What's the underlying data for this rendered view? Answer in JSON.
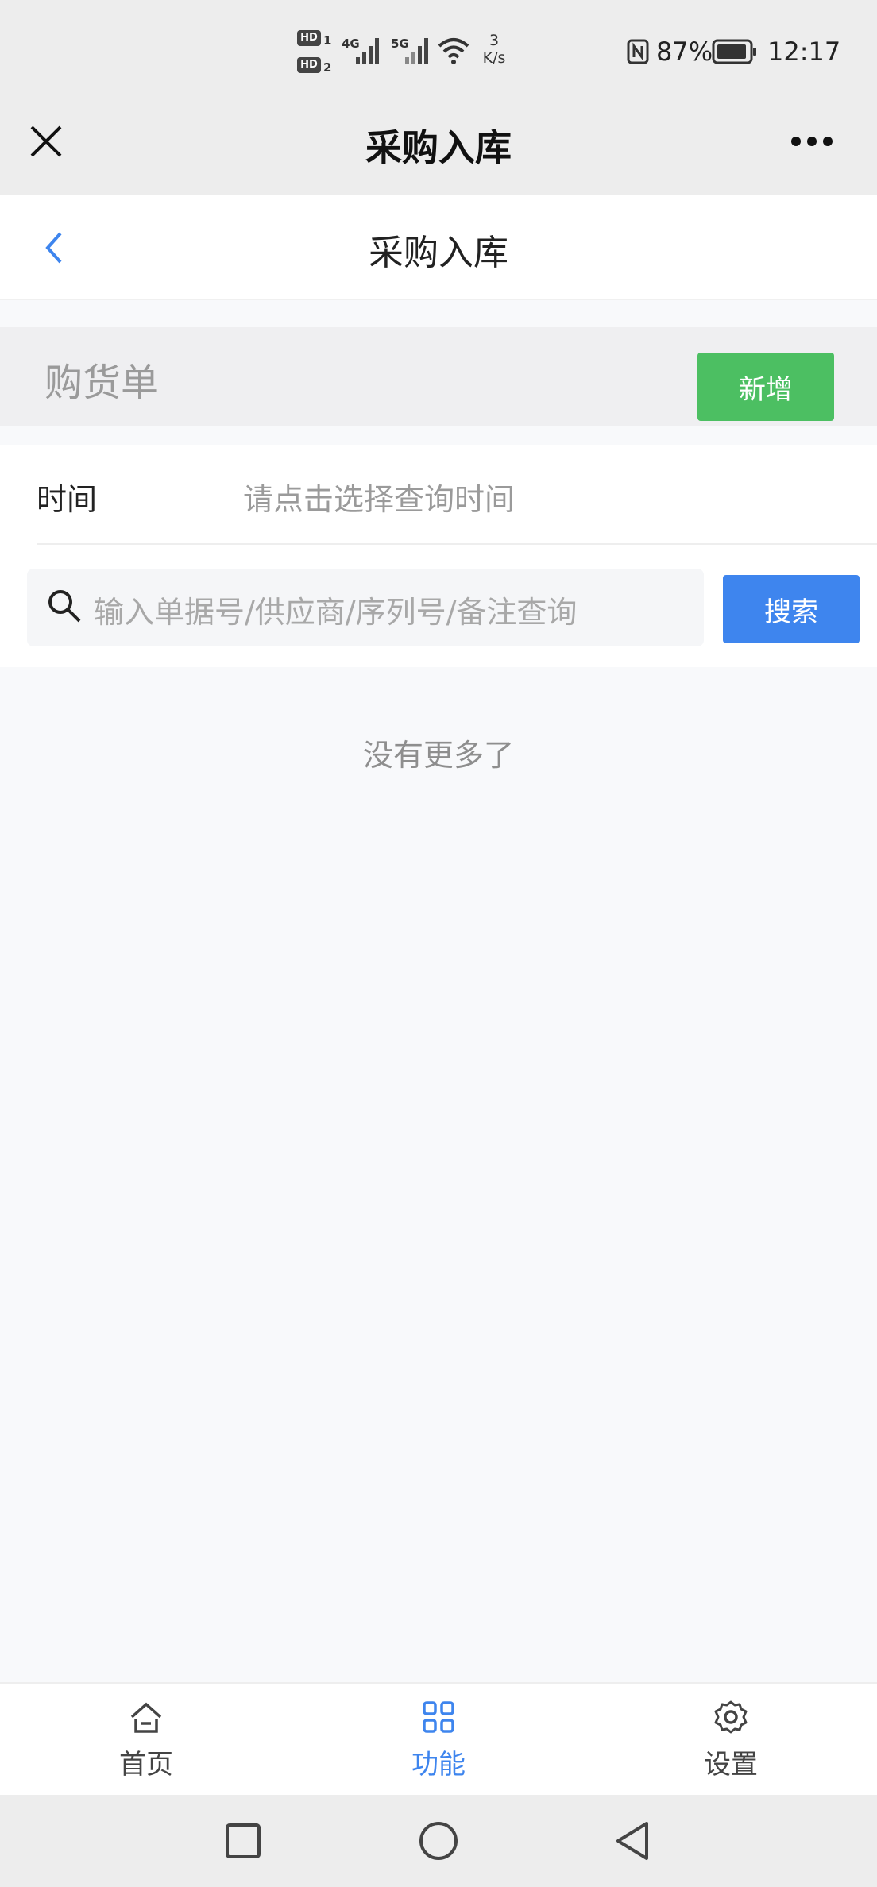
{
  "status_bar": {
    "hd1": "HD",
    "hd1_sub": "1",
    "hd2": "HD",
    "hd2_sub": "2",
    "net4g": "4G",
    "net5g": "5G",
    "speed_value": "3",
    "speed_unit": "K/s",
    "battery": "87%",
    "time": "12:17"
  },
  "wechat_bar": {
    "title": "采购入库"
  },
  "header": {
    "title": "采购入库"
  },
  "section": {
    "title": "购货单",
    "add_label": "新增"
  },
  "filter": {
    "time_label": "时间",
    "time_placeholder": "请点击选择查询时间",
    "search_placeholder": "输入单据号/供应商/序列号/备注查询",
    "search_button": "搜索"
  },
  "list": {
    "empty_text": "没有更多了"
  },
  "tabbar": {
    "items": [
      {
        "label": "首页",
        "icon": "home-icon"
      },
      {
        "label": "功能",
        "icon": "grid-icon",
        "active": true
      },
      {
        "label": "设置",
        "icon": "gear-icon"
      }
    ]
  },
  "colors": {
    "accent_blue": "#3e85ee",
    "add_green": "#4cbf62"
  }
}
